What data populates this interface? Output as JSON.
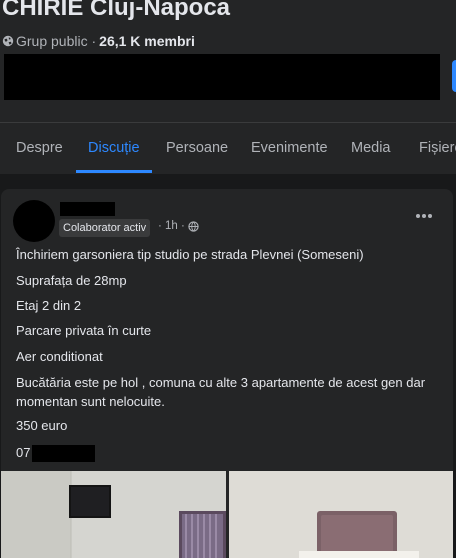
{
  "group": {
    "title": "CHIRIE Cluj-Napoca",
    "privacy": "Grup public ·",
    "members": "26,1 K membri"
  },
  "tabs": [
    {
      "label": "Despre"
    },
    {
      "label": "Discuție"
    },
    {
      "label": "Persoane"
    },
    {
      "label": "Evenimente"
    },
    {
      "label": "Media"
    },
    {
      "label": "Fișiere"
    }
  ],
  "active_tab": "Discuție",
  "post": {
    "badge": "Colaborator activ",
    "time": "· 1h ·",
    "lines": [
      "Închiriem garsoniera tip studio pe strada Plevnei (Someseni)",
      "Suprafața de 28mp",
      "Etaj 2 din 2",
      "Parcare privata în curte",
      "Aer conditionat",
      "Bucătăria este pe hol , comuna cu alte 3 apartamente de acest gen dar",
      "momentan sunt nelocuite.",
      "350 euro"
    ],
    "phone_prefix": "07"
  },
  "colors": {
    "background": "#18191a",
    "surface": "#242526",
    "accent": "#2d88ff",
    "text": "#e4e6eb",
    "muted": "#b0b3b8"
  },
  "icons": [
    "globe-icon",
    "more-options-icon"
  ]
}
